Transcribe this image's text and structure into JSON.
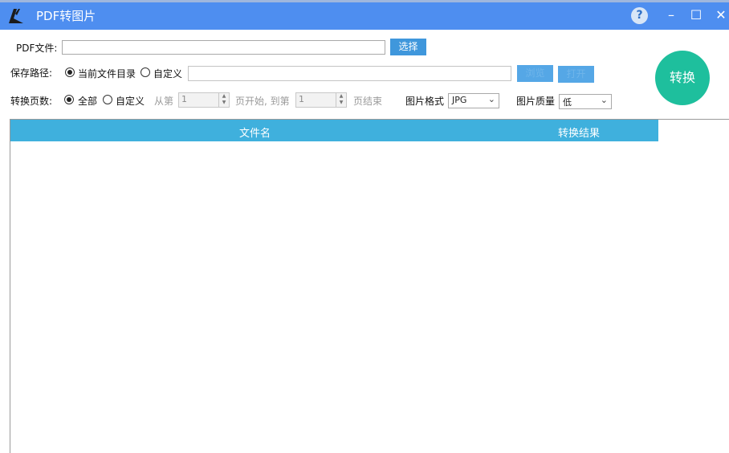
{
  "window": {
    "title": "PDF转图片",
    "help_glyph": "?",
    "minimize_glyph": "–",
    "maximize_glyph": "☐",
    "close_glyph": "✕",
    "accent": "#4e8ef0"
  },
  "pdf_file": {
    "label": "PDF文件:",
    "value": "",
    "select_button": "选择"
  },
  "save_path": {
    "label": "保存路径:",
    "option_current": "当前文件目录",
    "option_custom": "自定义",
    "selected": "当前文件目录",
    "value": "",
    "browse_button": "浏览",
    "open_button": "打开"
  },
  "pages": {
    "label": "转换页数:",
    "option_all": "全部",
    "option_custom": "自定义",
    "selected": "全部",
    "from_label": "从第",
    "from_value": "1",
    "mid_label": "页开始, 到第",
    "to_value": "1",
    "end_label": "页结束"
  },
  "format": {
    "label": "图片格式",
    "value": "JPG"
  },
  "quality": {
    "label": "图片质量",
    "value": "低"
  },
  "convert_button": "转换",
  "table": {
    "columns": [
      "文件名",
      "转换结果"
    ],
    "rows": []
  }
}
